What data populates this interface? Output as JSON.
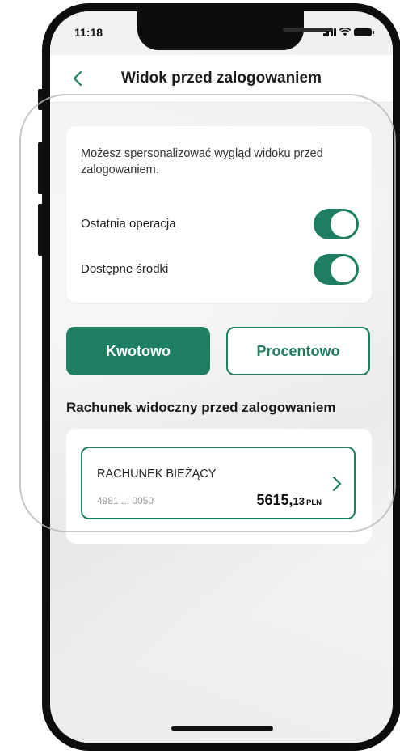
{
  "status_bar": {
    "time": "11:18"
  },
  "header": {
    "title": "Widok przed zalogowaniem"
  },
  "settings": {
    "description": "Możesz spersonalizować wygląd widoku przed zalogowaniem.",
    "toggles": [
      {
        "label": "Ostatnia operacja",
        "state": "on"
      },
      {
        "label": "Dostępne środki",
        "state": "on"
      }
    ]
  },
  "display_mode": {
    "options": [
      "Kwotowo",
      "Procentowo"
    ],
    "selected": "Kwotowo"
  },
  "section": {
    "title": "Rachunek widoczny przed  zalogowaniem"
  },
  "account": {
    "name": "RACHUNEK BIEŻĄCY",
    "number": "4981 ... 0050",
    "amount_int": "5615,",
    "amount_dec": "13",
    "currency": "PLN"
  },
  "colors": {
    "accent": "#1e7e62",
    "background": "#f3f3f3"
  },
  "icons": {
    "back": "chevron-left-icon",
    "account_go": "chevron-right-icon"
  }
}
